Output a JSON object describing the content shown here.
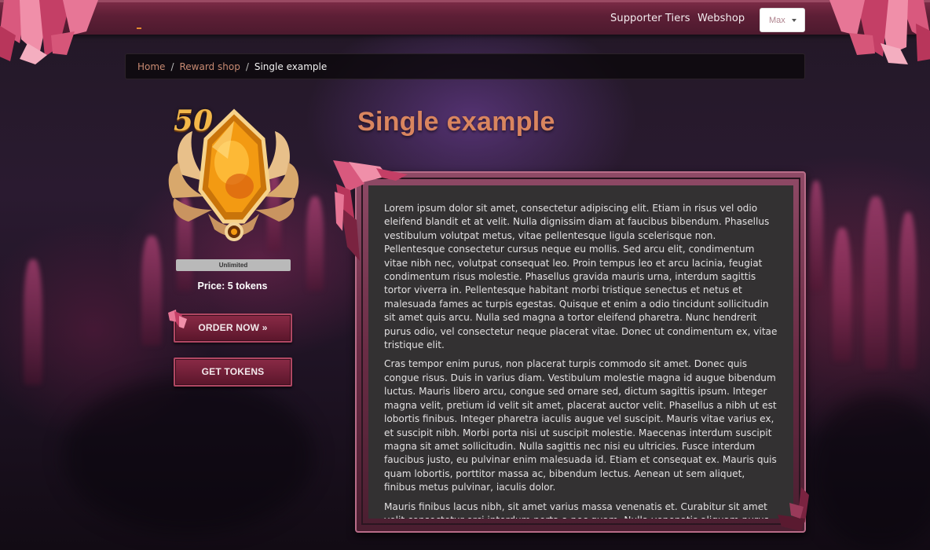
{
  "nav": {
    "links": [
      "Supporter Tiers",
      "Webshop"
    ],
    "user": {
      "label": "Max"
    }
  },
  "breadcrumb": {
    "items": [
      "Home",
      "Reward shop"
    ],
    "current": "Single example"
  },
  "reward": {
    "badge_number": "50",
    "stock_label": "Unlimited",
    "price_label": "Price: 5 tokens",
    "order_button": "ORDER NOW »",
    "tokens_button": "GET TOKENS"
  },
  "page": {
    "title": "Single example",
    "paragraphs": [
      "Lorem ipsum dolor sit amet, consectetur adipiscing elit. Etiam in risus vel odio eleifend blandit et at velit. Nulla dignissim diam at faucibus bibendum. Phasellus vestibulum volutpat metus, vitae pellentesque ligula scelerisque non. Pellentesque consectetur cursus neque eu mollis. Sed arcu elit, condimentum vitae nibh nec, volutpat consequat leo. Proin tempus leo et arcu lacinia, feugiat condimentum risus molestie. Phasellus gravida mauris urna, interdum sagittis tortor viverra in. Pellentesque habitant morbi tristique senectus et netus et malesuada fames ac turpis egestas. Quisque et enim a odio tincidunt sollicitudin sit amet quis arcu. Nulla sed magna a tortor eleifend pharetra. Nunc hendrerit purus odio, vel consectetur neque placerat vitae. Donec ut condimentum ex, vitae tristique elit.",
      "Cras tempor enim purus, non placerat turpis commodo sit amet. Donec quis congue risus. Duis in varius diam. Vestibulum molestie magna id augue bibendum luctus. Mauris libero arcu, congue sed ornare sed, dictum sagittis ipsum. Integer magna velit, pretium id velit sit amet, placerat auctor velit. Phasellus a nibh ut est lobortis finibus. Integer pharetra iaculis augue vel suscipit. Mauris vitae varius ex, et suscipit nibh. Morbi porta nisi ut suscipit molestie. Maecenas interdum suscipit magna sit amet sollicitudin. Nulla sagittis nec nisi eu ultricies. Fusce interdum faucibus justo, eu pulvinar enim malesuada id. Etiam et consequat ex. Mauris quis quam lobortis, porttitor massa ac, bibendum lectus. Aenean ut sem aliquet, finibus metus pulvinar, iaculis dolor.",
      "Mauris finibus lacus nibh, sit amet varius massa venenatis et. Curabitur sit amet velit consectetur orci interdum porta a nec quam. Nulla venenatis aliquam purus vitae euismod. Morbi interdum varius ante vel luctus. In vulputate sem ut augue aliquet feugiat. Morbi blandit libero gravida nunc accumsan aliquam. Nam eget elementum elit."
    ]
  },
  "colors": {
    "accent": "#d9855f",
    "nav_bar": "#5e1f36",
    "button": "#7a2340",
    "link": "#c88a72"
  },
  "icons": [
    "crystal-cluster-icon",
    "reward-gem-badge-icon",
    "dropdown-caret-icon"
  ]
}
